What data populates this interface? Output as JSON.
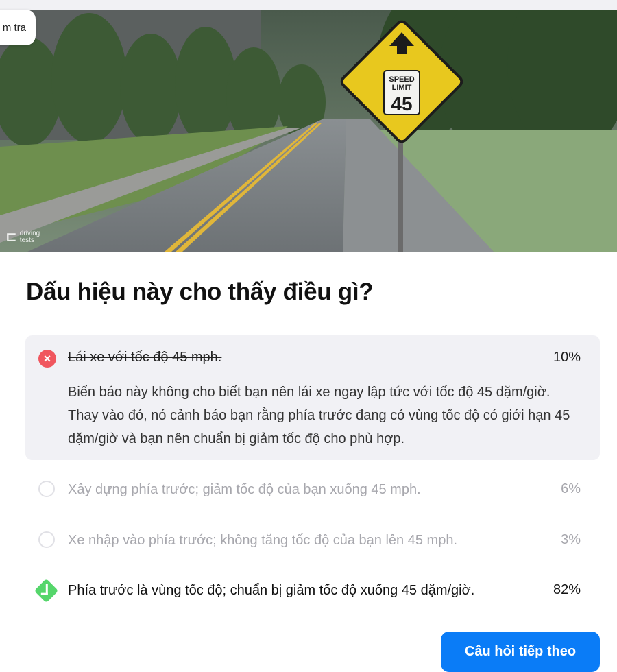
{
  "header": {
    "tab_label": "m tra"
  },
  "image": {
    "sign_line1": "SPEED",
    "sign_line2": "LIMIT",
    "sign_value": "45",
    "watermark_line1": "driving",
    "watermark_line2": "tests"
  },
  "question": {
    "title": "Dấu hiệu này cho thấy điều gì?"
  },
  "answers": [
    {
      "text": "Lái xe với tốc độ 45 mph.",
      "percent": "10%",
      "status": "wrong",
      "explanation": "Biển báo này không cho biết bạn nên lái xe ngay lập tức với tốc độ 45 dặm/giờ. Thay vào đó, nó cảnh báo bạn rằng phía trước đang có vùng tốc độ có giới hạn 45 dặm/giờ và bạn nên chuẩn bị giảm tốc độ cho phù hợp."
    },
    {
      "text": "Xây dựng phía trước; giảm tốc độ của bạn xuống 45 mph.",
      "percent": "6%",
      "status": "unselected"
    },
    {
      "text": "Xe nhập vào phía trước; không tăng tốc độ của bạn lên 45 mph.",
      "percent": "3%",
      "status": "unselected"
    },
    {
      "text": "Phía trước là vùng tốc độ; chuẩn bị giảm tốc độ xuống 45 dặm/giờ.",
      "percent": "82%",
      "status": "correct"
    }
  ],
  "footer": {
    "next_button": "Câu hỏi tiếp theo"
  },
  "colors": {
    "wrong": "#f0565e",
    "correct": "#55d66b",
    "primary": "#0a7cf7",
    "selected_bg": "#f1f1f5",
    "muted_text": "#a7a7ad"
  }
}
